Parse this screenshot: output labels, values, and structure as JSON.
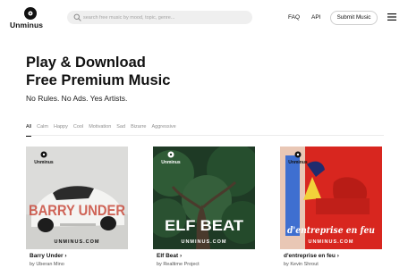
{
  "header": {
    "logo_text": "Unminus",
    "search_placeholder": "search free music by mood, topic, genre...",
    "nav": {
      "faq": "FAQ",
      "api": "API"
    },
    "submit_label": "Submit Music",
    "icons": {
      "logo": "vinyl-note-icon",
      "search": "search-icon",
      "menu": "hamburger-menu-icon"
    }
  },
  "hero": {
    "title_line1": "Play & Download",
    "title_line2": "Free Premium Music",
    "subtitle": "No Rules. No Ads. Yes Artists."
  },
  "filters": [
    "All",
    "Calm",
    "Happy",
    "Cool",
    "Motivation",
    "Sad",
    "Bizarre",
    "Aggressive"
  ],
  "active_filter": "All",
  "cards": [
    {
      "title": "Barry Under",
      "artist": "by Uberan Mino",
      "cover_brand": "Unminus",
      "cover_text": "BARRY UNDER",
      "cover_domain": "UNMINUS.COM"
    },
    {
      "title": "Elf Beat",
      "artist": "by Realtime Project",
      "cover_brand": "Unminus",
      "cover_text": "ELF BEAT",
      "cover_domain": "UNMINUS.COM"
    },
    {
      "title": "d'entreprise en feu",
      "artist": "by Kevin Shrout",
      "cover_brand": "Unminus",
      "cover_text": "d'entreprise en feu",
      "cover_domain": "UNMINUS.COM"
    }
  ],
  "colors": {
    "accent": "#111111",
    "muted": "#8f8f8f",
    "search_bg": "#efefef",
    "card3_red": "#d8261f",
    "card1_red": "#c84a3c"
  }
}
